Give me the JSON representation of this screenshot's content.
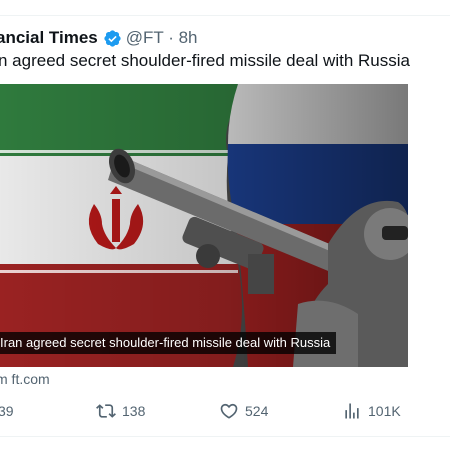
{
  "tweet": {
    "author_name": "ancial Times",
    "handle_time": "@FT · 8h",
    "headline": "n agreed secret shoulder-fired missile deal with Russia",
    "card": {
      "caption": "Iran agreed secret shoulder-fired missile deal with Russia",
      "source": "m ft.com"
    },
    "actions": {
      "replies": "39",
      "reposts": "138",
      "likes": "524",
      "views": "101K"
    }
  },
  "colors": {
    "verified_blue": "#1d9bf0",
    "secondary_text": "#536471",
    "flag_green": "#239f40",
    "flag_red": "#da0000",
    "russia_blue": "#0039a6"
  },
  "icons": [
    "verified-badge-icon",
    "reply-icon",
    "repost-icon",
    "like-icon",
    "views-icon"
  ]
}
